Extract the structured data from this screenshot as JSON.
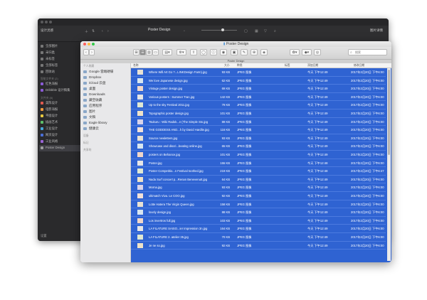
{
  "dark_window": {
    "app_title": "设计灵感",
    "folder_title": "Poster Design",
    "right_label": "图片详情",
    "sidebar": {
      "items": [
        {
          "label": "全部图片"
        },
        {
          "label": "未归类"
        },
        {
          "label": "未标签"
        },
        {
          "label": "全部标签"
        },
        {
          "label": "回收站"
        }
      ],
      "smart_section": "智能文件夹 (2)",
      "smart_items": [
        {
          "label": "红色海报"
        },
        {
          "label": "Dribbble 设计稿集"
        }
      ],
      "folder_section": "文件夹 (8)",
      "folders": [
        {
          "label": "美陈设计"
        },
        {
          "label": "电影海报"
        },
        {
          "label": "平面设计"
        },
        {
          "label": "插画艺术"
        },
        {
          "label": "工业设计"
        },
        {
          "label": "网页设计"
        },
        {
          "label": "工业风格"
        },
        {
          "label": "Poster Design"
        }
      ],
      "settings_label": "设置"
    }
  },
  "finder": {
    "title": "Poster Design",
    "path": "Poster Design",
    "search_placeholder": "搜索",
    "toolbar": {
      "back": "‹",
      "forward": "›",
      "view_icons": "⊞",
      "view_list": "☰",
      "view_columns": "▥",
      "view_gallery": "▭"
    },
    "sidebar": {
      "favorites_header": "个人收藏",
      "items": [
        {
          "label": "Google 雲端硬碟"
        },
        {
          "label": "Dropbox"
        },
        {
          "label": "iCloud 云盘"
        },
        {
          "label": "桌面"
        },
        {
          "label": "Downloads"
        },
        {
          "label": "藏空收藏"
        },
        {
          "label": "应用程序"
        },
        {
          "label": "图片"
        },
        {
          "label": "文稿"
        },
        {
          "label": "Eagle library"
        },
        {
          "label": "健康云"
        }
      ],
      "devices_header": "设备",
      "tags_header": "标记",
      "shared_header": "共享的"
    },
    "columns": {
      "name": "名称",
      "size": "大小",
      "kind": "种类",
      "tags": "标签",
      "date_added": "添加日期",
      "date_modified": "修改日期"
    },
    "rows": [
      {
        "name": "Where Will Art Go ?...LINKDesign Farm).jpg",
        "size": "93 KB",
        "kind": "JPEG 图像",
        "added": "今天 下午12:49",
        "modified": "2017年2月20日 下午6:00"
      },
      {
        "name": "We love Japanese design.jpg",
        "size": "62 KB",
        "kind": "JPEG 图像",
        "added": "今天 下午12:49",
        "modified": "2017年2月20日 下午6:00"
      },
      {
        "name": "Vintage poster design.jpg",
        "size": "69 KB",
        "kind": "JPEG 图像",
        "added": "今天 下午12:49",
        "modified": "2017年2月20日 下午6:00"
      },
      {
        "name": "Various posters : Summer Tran.jpg",
        "size": "142 KB",
        "kind": "JPEG 图像",
        "added": "今天 下午12:49",
        "modified": "2017年2月20日 下午6:00"
      },
      {
        "name": "Up to the sky Festival 2011.jpg",
        "size": "79 KB",
        "kind": "JPEG 图像",
        "added": "今天 下午12:49",
        "modified": "2017年2月20日 下午6:00"
      },
      {
        "name": "Topographic poster design.jpg",
        "size": "101 KB",
        "kind": "JPEG 图像",
        "added": "今天 下午12:49",
        "modified": "2017年2月20日 下午6:00"
      },
      {
        "name": "Tsukuru : Wiki Radok...n (The Simple Sto.jpg",
        "size": "89 KB",
        "kind": "JPEG 图像",
        "added": "今天 下午12:49",
        "modified": "2017年2月20日 下午6:00"
      },
      {
        "name": "THE GODDESS AND...h by David Hardlie.jpg",
        "size": "116 KB",
        "kind": "JPEG 图像",
        "added": "今天 下午12:49",
        "modified": "2017年2月20日 下午6:00"
      },
      {
        "name": "Source newletters.jpg",
        "size": "93 KB",
        "kind": "JPEG 图像",
        "added": "今天 下午12:49",
        "modified": "2017年2月20日 下午6:00"
      },
      {
        "name": "Showcase and discri...beating online.jpg",
        "size": "65 KB",
        "kind": "JPEG 图像",
        "added": "今天 下午12:49",
        "modified": "2017年2月20日 下午6:00"
      },
      {
        "name": "posters on Behance.jpg",
        "size": "101 KB",
        "kind": "JPEG 图像",
        "added": "今天 下午12:49",
        "modified": "2017年2月20日 下午6:00"
      },
      {
        "name": "Poster.jpg",
        "size": "155 KB",
        "kind": "JPEG 图像",
        "added": "今天 下午12:48",
        "modified": "2017年2月20日 下午6:00"
      },
      {
        "name": "Poster Competitio...n Festival toothed.jpg",
        "size": "219 KB",
        "kind": "JPEG 图像",
        "added": "今天 下午12:48",
        "modified": "2017年2月20日 下午6:47"
      },
      {
        "name": "Nada Surf concert p...Renan Benevenutt.jpg",
        "size": "64 KB",
        "kind": "JPEG 图像",
        "added": "今天 下午12:49",
        "modified": "2017年2月20日 下午6:00"
      },
      {
        "name": "Morna.jpg",
        "size": "93 KB",
        "kind": "JPEG 图像",
        "added": "今天 下午12:49",
        "modified": "2017年2月20日 下午6:00"
      },
      {
        "name": "ultimatch Viva. Le COO.jpg",
        "size": "92 KB",
        "kind": "JPEG 图像",
        "added": "今天 下午12:49",
        "modified": "2017年2月20日 下午6:00"
      },
      {
        "name": "Lotte Hatera The Virgin Queen.jpg",
        "size": "158 KB",
        "kind": "JPEG 图像",
        "added": "今天 下午12:49",
        "modified": "2017年2月20日 下午6:00"
      },
      {
        "name": "lovely design.jpg",
        "size": "88 KB",
        "kind": "JPEG 图像",
        "added": "今天 下午12:49",
        "modified": "2017年2月20日 下午6:00"
      },
      {
        "name": "Los invertros full.jpg",
        "size": "103 KB",
        "kind": "JPEG 图像",
        "added": "今天 下午12:49",
        "modified": "2017年2月20日 下午6:00"
      },
      {
        "name": "LA FILATURE SAISO...ier Impression 3n.jpg",
        "size": "164 KB",
        "kind": "JPEG 图像",
        "added": "今天 下午12:49",
        "modified": "2017年2月20日 下午6:00"
      },
      {
        "name": "LA FILATURE 2. atelier 35.jpg",
        "size": "70 KB",
        "kind": "JPEG 图像",
        "added": "今天 下午12:49",
        "modified": "2017年2月20日 下午6:00"
      },
      {
        "name": "Je ne so.jpg",
        "size": "92 KB",
        "kind": "JPEG 图像",
        "added": "今天 下午12:49",
        "modified": "2017年2月20日 下午6:00"
      }
    ]
  }
}
